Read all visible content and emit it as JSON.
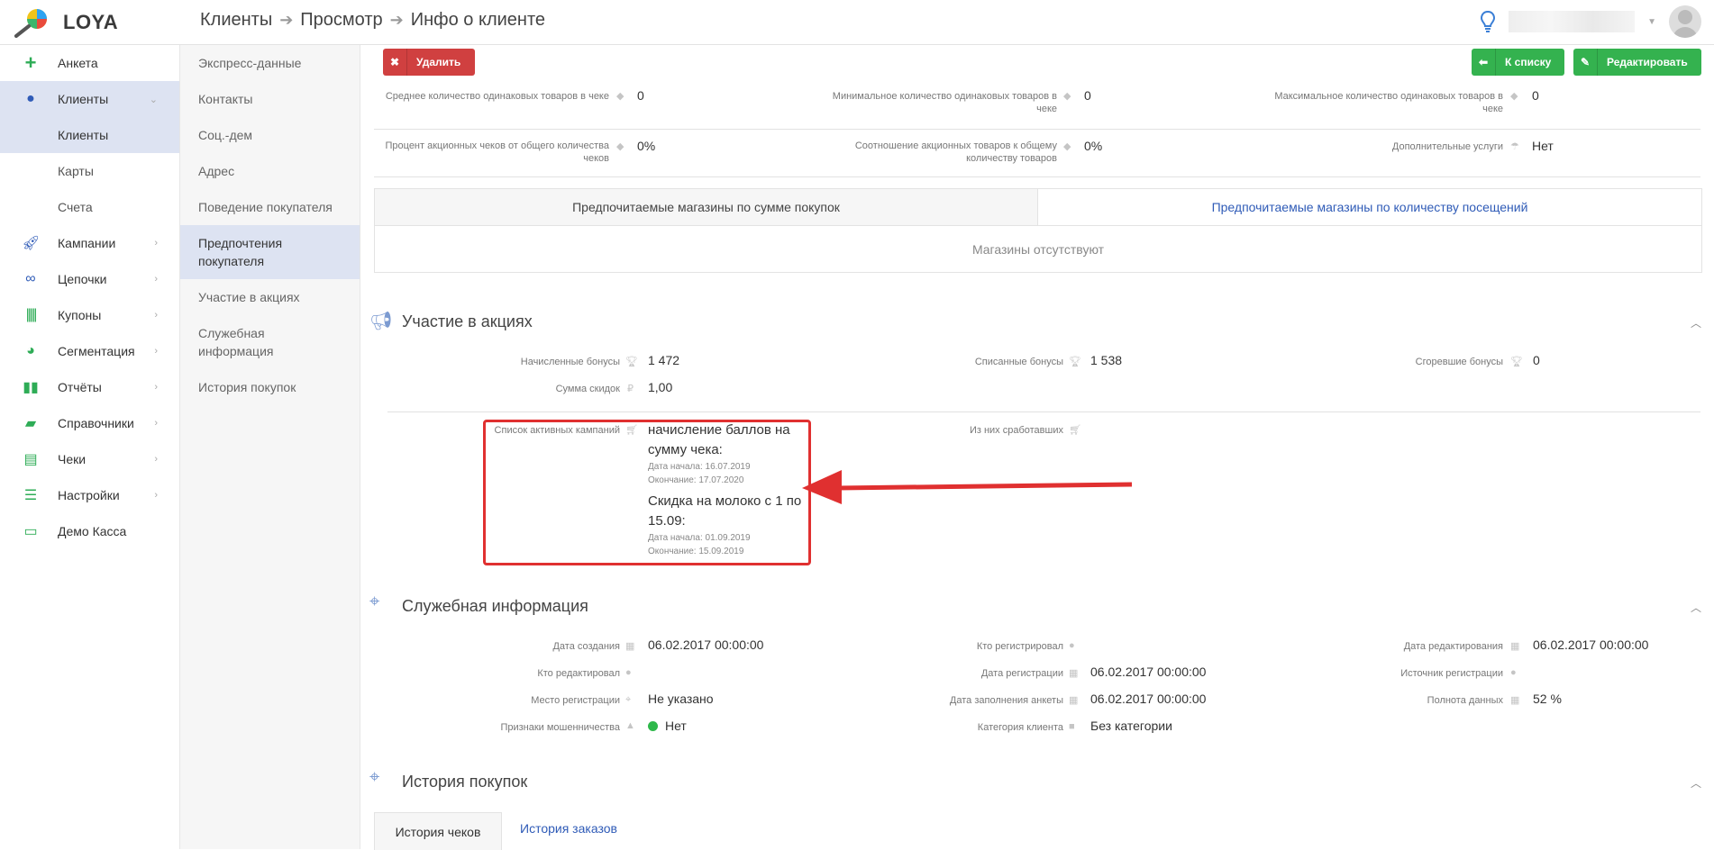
{
  "app": {
    "name": "LOYA"
  },
  "breadcrumb": [
    "Клиенты",
    "Просмотр",
    "Инфо о клиенте"
  ],
  "sidebar": {
    "items": [
      {
        "label": "Анкета",
        "icon": "plus-icon"
      },
      {
        "label": "Клиенты",
        "icon": "user-icon",
        "active": true
      },
      {
        "label": "Клиенты",
        "sub": true,
        "active": true
      },
      {
        "label": "Карты",
        "sub": true
      },
      {
        "label": "Счета",
        "sub": true
      },
      {
        "label": "Кампании",
        "icon": "rocket-icon"
      },
      {
        "label": "Цепочки",
        "icon": "link-icon"
      },
      {
        "label": "Купоны",
        "icon": "barcode-icon"
      },
      {
        "label": "Сегментация",
        "icon": "pie-icon"
      },
      {
        "label": "Отчёты",
        "icon": "chart-icon"
      },
      {
        "label": "Справочники",
        "icon": "book-icon"
      },
      {
        "label": "Чеки",
        "icon": "receipt-icon"
      },
      {
        "label": "Настройки",
        "icon": "sliders-icon"
      },
      {
        "label": "Демо Касса",
        "icon": "laptop-icon"
      }
    ]
  },
  "subnav": [
    "Экспресс-данные",
    "Контакты",
    "Соц.-дем",
    "Адрес",
    "Поведение покупателя",
    "Предпочтения покупателя",
    "Участие в акциях",
    "Служебная информация",
    "История покупок"
  ],
  "buttons": {
    "delete": "Удалить",
    "to_list": "К списку",
    "edit": "Редактировать"
  },
  "stats": {
    "row1": [
      {
        "label": "Среднее количество одинаковых товаров в чеке",
        "value": "0"
      },
      {
        "label": "Минимальное количество одинаковых товаров в чеке",
        "value": "0"
      },
      {
        "label": "Максимальное количество одинаковых товаров в чеке",
        "value": "0"
      }
    ],
    "row2": [
      {
        "label": "Процент акционных чеков от общего количества чеков",
        "value": "0%"
      },
      {
        "label": "Соотношение акционных товаров к общему количеству товаров",
        "value": "0%"
      },
      {
        "label": "Дополнительные услуги",
        "value": "Нет"
      }
    ]
  },
  "stores_tabs": {
    "tab1": "Предпочитаемые магазины по сумме покупок",
    "tab2": "Предпочитаемые магазины по количеству посещений",
    "empty": "Магазины отсутствуют"
  },
  "promo": {
    "title": "Участие в акциях",
    "accrued_label": "Начисленные бонусы",
    "accrued": "1 472",
    "spent_label": "Списанные бонусы",
    "spent": "1 538",
    "burned_label": "Сгоревшие бонусы",
    "burned": "0",
    "discount_label": "Сумма скидок",
    "discount": "1,00",
    "active_label": "Список активных кампаний",
    "worked_label": "Из них сработавших",
    "campaigns": [
      {
        "name": "начисление баллов на сумму чека:",
        "start": "Дата начала: 16.07.2019",
        "end": "Окончание: 17.07.2020"
      },
      {
        "name": "Скидка на молоко с 1 по 15.09:",
        "start": "Дата начала: 01.09.2019",
        "end": "Окончание: 15.09.2019"
      }
    ]
  },
  "service": {
    "title": "Служебная информация",
    "created_label": "Дата создания",
    "created": "06.02.2017 00:00:00",
    "registered_by_label": "Кто регистрировал",
    "edited_date_label": "Дата редактирования",
    "edited_date": "06.02.2017 00:00:00",
    "edited_by_label": "Кто редактировал",
    "reg_date_label": "Дата регистрации",
    "reg_date": "06.02.2017 00:00:00",
    "reg_source_label": "Источник регистрации",
    "reg_place_label": "Место регистрации",
    "reg_place": "Не указано",
    "form_date_label": "Дата заполнения анкеты",
    "form_date": "06.02.2017 00:00:00",
    "completeness_label": "Полнота данных",
    "completeness": "52 %",
    "fraud_label": "Признаки мошенничества",
    "fraud": "Нет",
    "category_label": "Категория клиента",
    "category": "Без категории"
  },
  "history": {
    "title": "История покупок",
    "tab_checks": "История чеков",
    "tab_orders": "История заказов"
  },
  "colors": {
    "accent_green": "#34b24f",
    "danger": "#d04040",
    "link": "#2f5bb7",
    "active_bg": "#dde3f2",
    "annotation": "#e03030"
  }
}
